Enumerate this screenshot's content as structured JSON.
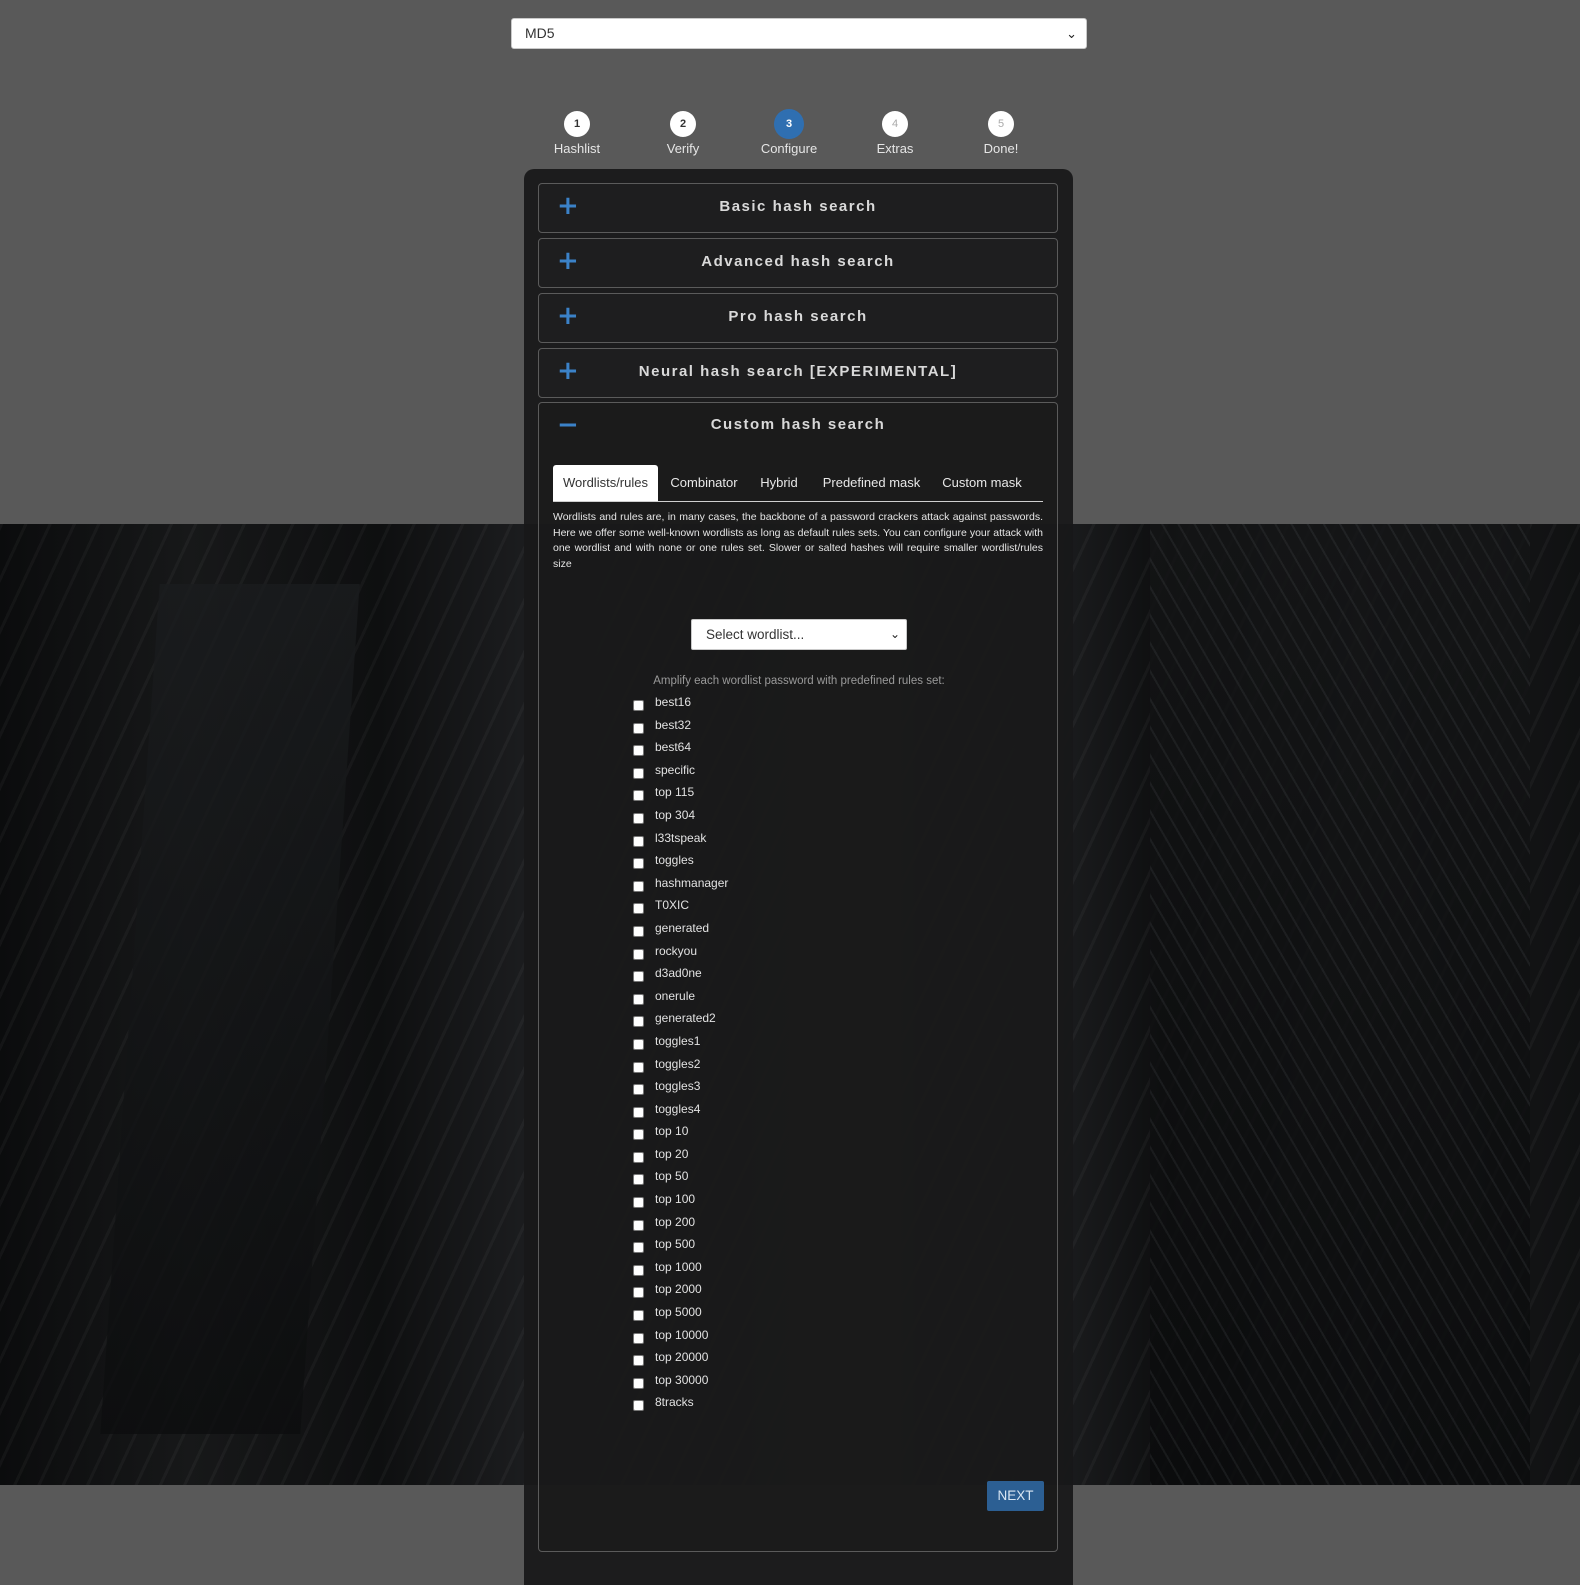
{
  "hash_type": {
    "selected": "MD5"
  },
  "stepper": {
    "steps": [
      {
        "number": "1",
        "label": "Hashlist"
      },
      {
        "number": "2",
        "label": "Verify"
      },
      {
        "number": "3",
        "label": "Configure"
      },
      {
        "number": "4",
        "label": "Extras"
      },
      {
        "number": "5",
        "label": "Done!"
      }
    ],
    "active_step": 3
  },
  "accordion": {
    "sections": [
      {
        "title": "Basic hash search",
        "sign": "+"
      },
      {
        "title": "Advanced hash search",
        "sign": "+"
      },
      {
        "title": "Pro hash search",
        "sign": "+"
      },
      {
        "title": "Neural hash search [EXPERIMENTAL]",
        "sign": "+"
      },
      {
        "title": "Custom hash search",
        "sign": "−"
      }
    ]
  },
  "custom": {
    "tabs": [
      "Wordlists/rules",
      "Combinator",
      "Hybrid",
      "Predefined mask",
      "Custom mask"
    ],
    "active_tab": "Wordlists/rules",
    "description": "Wordlists and rules are, in many cases, the backbone of a password crackers attack against passwords. Here we offer some well-known wordlists as long as default rules sets. You can configure your attack with one wordlist and with none or one rules set. Slower or salted hashes will require smaller wordlist/rules size",
    "wordlist_select": "Select wordlist...",
    "amplify_label": "Amplify each wordlist password with predefined rules set:",
    "rules": [
      "best16",
      "best32",
      "best64",
      "specific",
      "top 115",
      "top 304",
      "l33tspeak",
      "toggles",
      "hashmanager",
      "T0XIC",
      "generated",
      "rockyou",
      "d3ad0ne",
      "onerule",
      "generated2",
      "toggles1",
      "toggles2",
      "toggles3",
      "toggles4",
      "top 10",
      "top 20",
      "top 50",
      "top 100",
      "top 200",
      "top 500",
      "top 1000",
      "top 2000",
      "top 5000",
      "top 10000",
      "top 20000",
      "top 30000",
      "8tracks"
    ],
    "next_label": "NEXT"
  },
  "colors": {
    "accent": "#2f6fb1",
    "page_background": "#595959",
    "panel_background": "#181819"
  },
  "icons": {
    "expand": "plus-icon",
    "collapse": "minus-icon",
    "dropdown": "chevron-down-icon"
  }
}
